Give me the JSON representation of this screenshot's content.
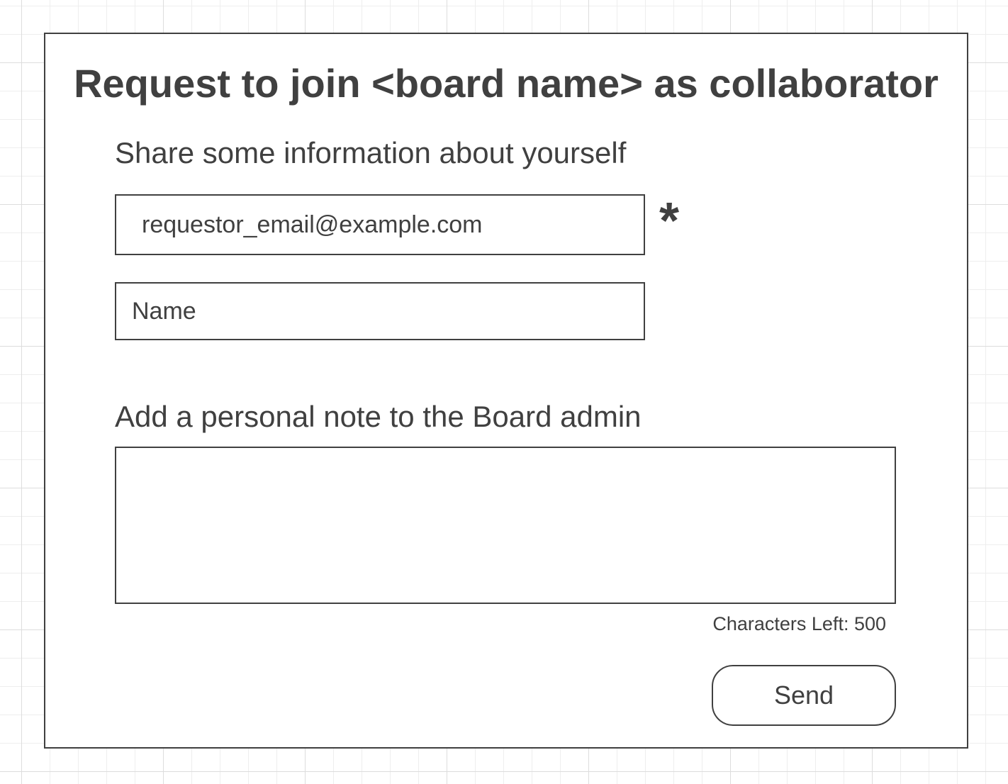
{
  "dialog": {
    "title": "Request to join <board name> as collaborator",
    "info_label": "Share some information about yourself",
    "email": {
      "value": "requestor_email@example.com",
      "required_marker": "*"
    },
    "name": {
      "placeholder": "Name"
    },
    "note_label": "Add a personal note to the Board admin",
    "note": {
      "value": ""
    },
    "characters_left": "Characters Left: 500",
    "send_label": "Send"
  }
}
